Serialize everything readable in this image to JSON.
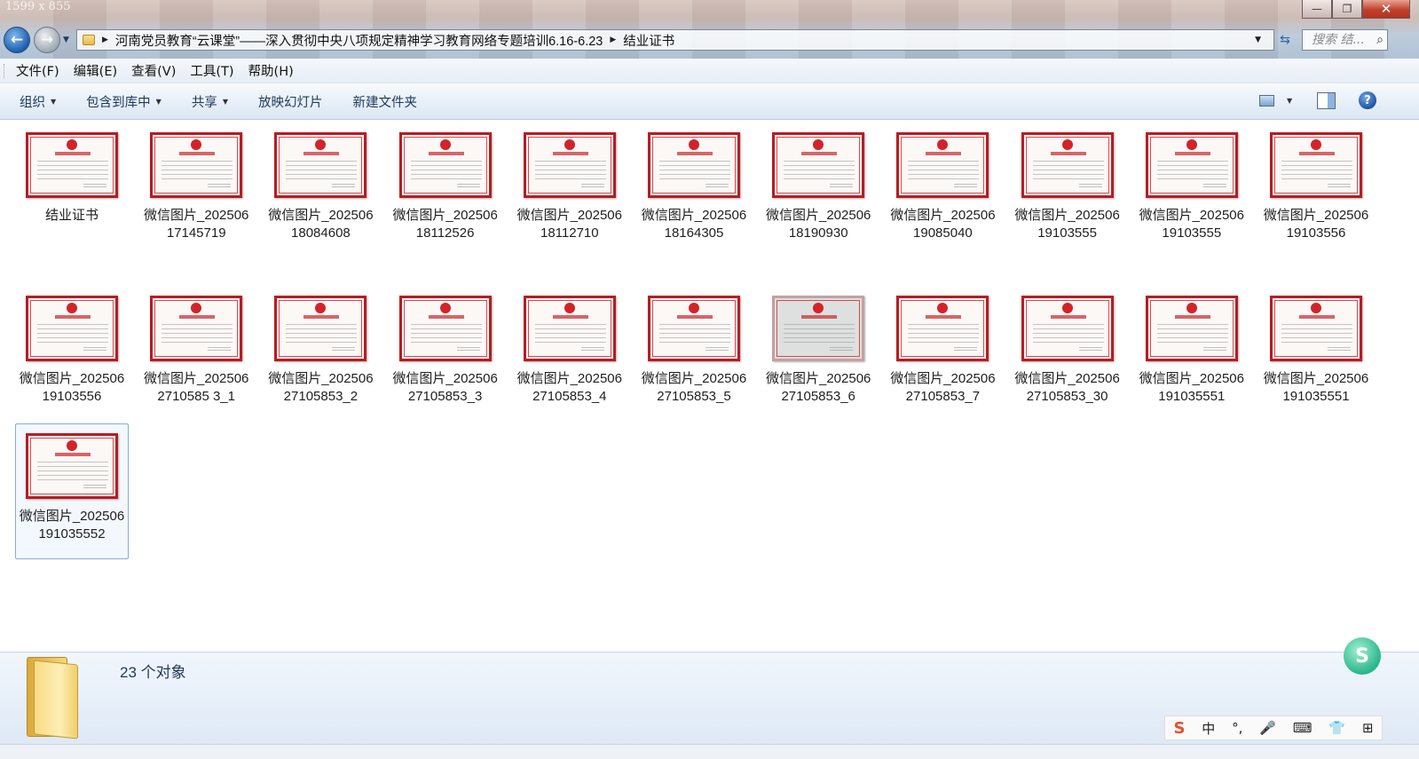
{
  "window": {
    "dimension_label": "1599 x 855",
    "buttons": {
      "minimize": "—",
      "maximize": "❐",
      "close": "✕"
    }
  },
  "address": {
    "segments": [
      "河南党员教育“云课堂”——深入贯彻中央八项规定精神学习教育网络专题培训6.16-6.23",
      "结业证书"
    ],
    "search_placeholder": "搜索 结..."
  },
  "menu": [
    "文件(F)",
    "编辑(E)",
    "查看(V)",
    "工具(T)",
    "帮助(H)"
  ],
  "commands": {
    "organize": "组织",
    "include_library": "包含到库中",
    "share": "共享",
    "slideshow": "放映幻灯片",
    "new_folder": "新建文件夹"
  },
  "files": [
    {
      "name": "结业证书"
    },
    {
      "name": "微信图片_20250617145719"
    },
    {
      "name": "微信图片_20250618084608"
    },
    {
      "name": "微信图片_20250618112526"
    },
    {
      "name": "微信图片_20250618112710"
    },
    {
      "name": "微信图片_20250618164305"
    },
    {
      "name": "微信图片_20250618190930"
    },
    {
      "name": "微信图片_20250619085040"
    },
    {
      "name": "微信图片_20250619103555"
    },
    {
      "name": "微信图片_20250619103555"
    },
    {
      "name": "微信图片_20250619103556"
    },
    {
      "name": "微信图片_20250619103556"
    },
    {
      "name": "微信图片_2025062710585 3_1"
    },
    {
      "name": "微信图片_20250627105853_2"
    },
    {
      "name": "微信图片_20250627105853_3"
    },
    {
      "name": "微信图片_20250627105853_4"
    },
    {
      "name": "微信图片_20250627105853_5"
    },
    {
      "name": "微信图片_20250627105853_6",
      "faded": true
    },
    {
      "name": "微信图片_20250627105853_7"
    },
    {
      "name": "微信图片_20250627105853_30"
    },
    {
      "name": "微信图片_202506191035551"
    },
    {
      "name": "微信图片_202506191035551"
    },
    {
      "name": "微信图片_202506191035552",
      "selected": true
    }
  ],
  "details": {
    "count": "23 个对象"
  },
  "ime": {
    "logo": "S",
    "mode": "中",
    "punct": "°,",
    "mic": "🎤",
    "keyboard": "⌨",
    "skin": "👕",
    "grid": "⊞"
  },
  "assistant_logo": "S"
}
